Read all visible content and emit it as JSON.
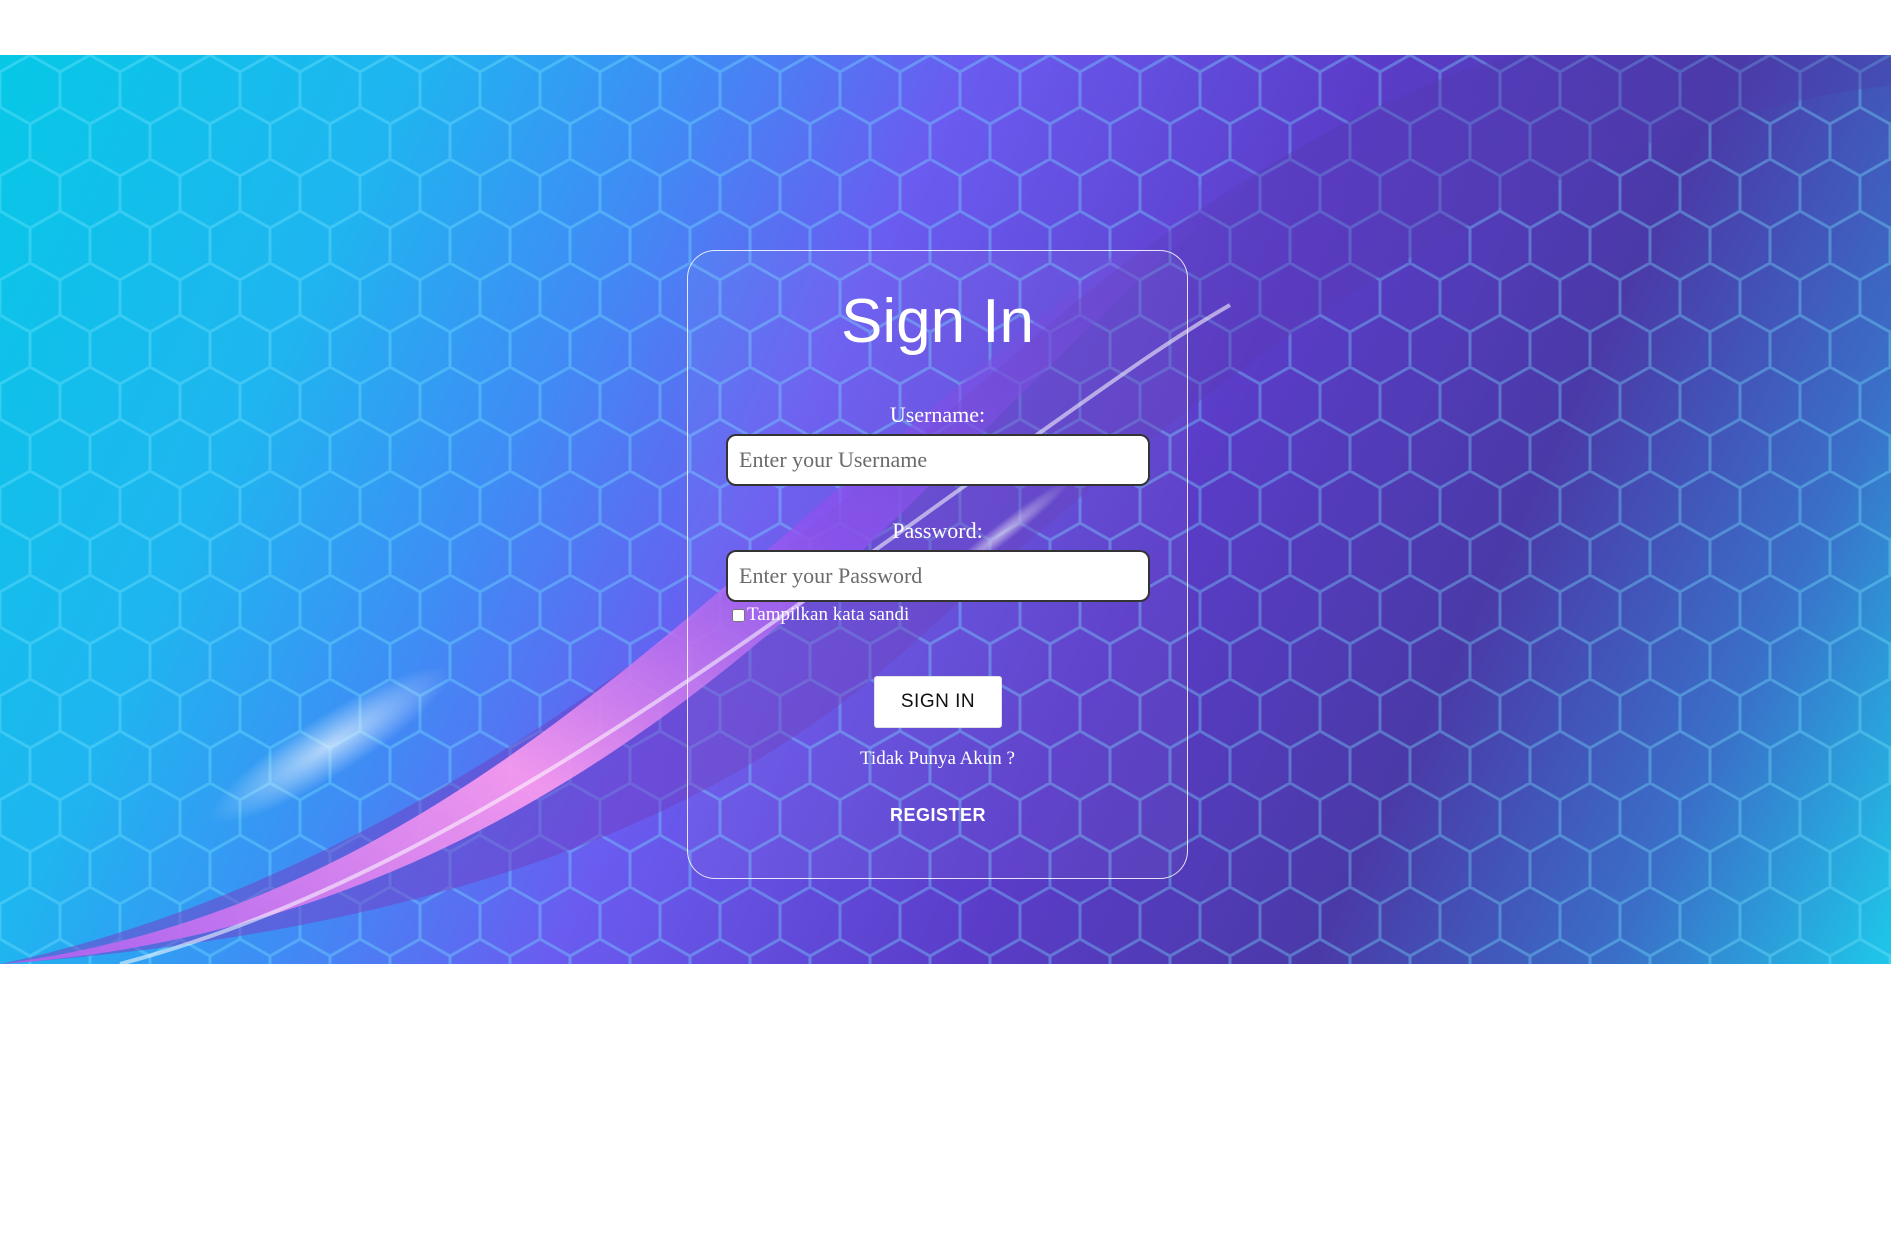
{
  "login": {
    "title": "Sign In",
    "username_label": "Username:",
    "username_placeholder": "Enter your Username",
    "password_label": "Password:",
    "password_placeholder": "Enter your Password",
    "show_password_label": "Tampilkan kata sandi",
    "show_password_checked": false,
    "signin_button": "SIGN IN",
    "no_account_text": "Tidak Punya Akun ?",
    "register_button": "REGISTER"
  },
  "colors": {
    "background_cyan": "#06c8e6",
    "background_purple": "#6a5cf0",
    "background_indigo": "#4a3aa8",
    "accent_pink": "#ff9ef0",
    "text": "#ffffff"
  }
}
